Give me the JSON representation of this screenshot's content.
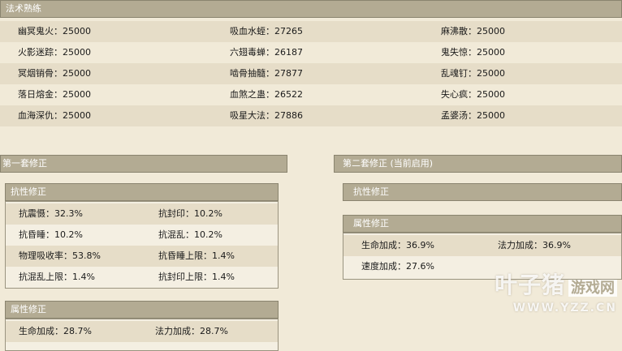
{
  "mastery": {
    "title": "法术熟练",
    "rows": [
      [
        "幽冥鬼火：25000",
        "吸血水蛭：27265",
        "麻沸散：25000"
      ],
      [
        "火影迷踪：25000",
        "六翅毒蝉：26187",
        "鬼失惊：25000"
      ],
      [
        "冥烟销骨：25000",
        "啮骨抽髓：27877",
        "乱魂钉：25000"
      ],
      [
        "落日熔金：25000",
        "血煞之蛊：26522",
        "失心疯：25000"
      ],
      [
        "血海深仇：25000",
        "吸星大法：27886",
        "孟婆汤：25000"
      ]
    ]
  },
  "set1": {
    "title": "第一套修正",
    "resist": {
      "title": "抗性修正",
      "rows": [
        [
          "抗震慑：32.3%",
          "抗封印：10.2%"
        ],
        [
          "抗昏睡：10.2%",
          "抗混乱：10.2%"
        ],
        [
          "物理吸收率：53.8%",
          "抗昏睡上限：1.4%"
        ],
        [
          "抗混乱上限：1.4%",
          "抗封印上限：1.4%"
        ]
      ]
    },
    "attr": {
      "title": "属性修正",
      "rows": [
        [
          "生命加成：28.7%",
          "法力加成：28.7%"
        ]
      ]
    }
  },
  "set2": {
    "title": "第二套修正 (当前启用)",
    "resist": {
      "title": "抗性修正"
    },
    "attr": {
      "title": "属性修正",
      "rows": [
        [
          "生命加成：36.9%",
          "法力加成：36.9%"
        ],
        [
          "速度加成：27.6%",
          ""
        ]
      ]
    }
  },
  "watermark": {
    "brand": "叶子猪",
    "tag": "游戏网",
    "url": "WWW.YZZ.CN"
  },
  "colors": {
    "header_bar": "#b3ab93",
    "row_alt": "#e6ddc8",
    "background": "#f1ead8"
  }
}
